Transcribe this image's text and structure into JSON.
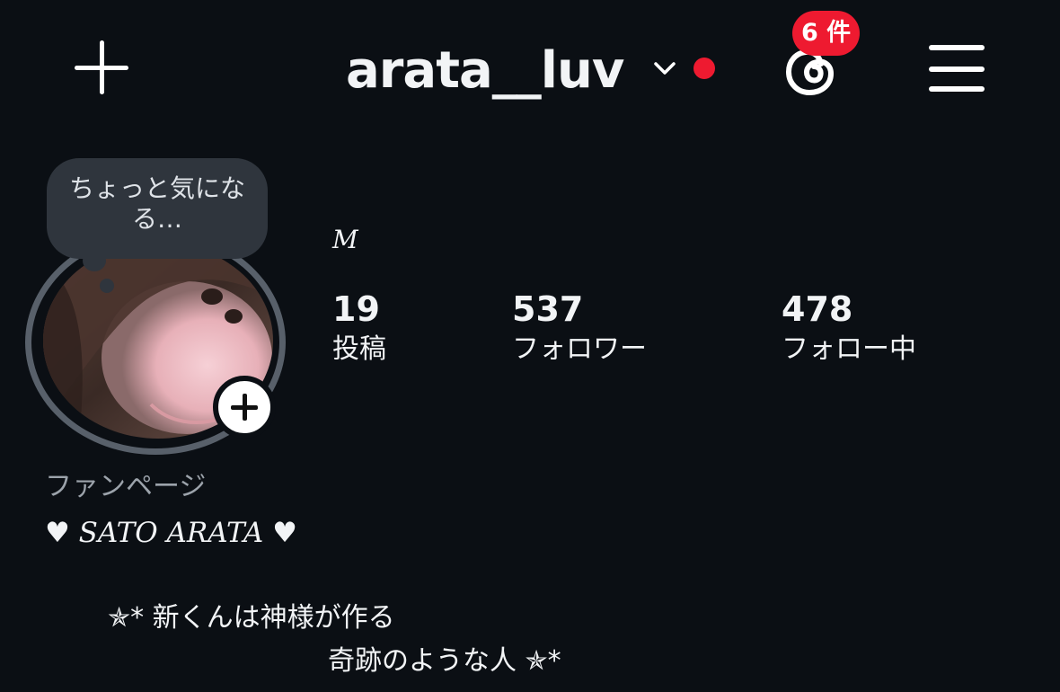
{
  "header": {
    "username": "arata__luv",
    "notification_badge": "6 件"
  },
  "note": {
    "text": "ちょっと気になる…"
  },
  "profile": {
    "display_name": "M",
    "category": "ファンページ",
    "bio_name": "♥ SATO ARATA ♥",
    "bio_line1": "✯* 新くんは神様が作る",
    "bio_line2": "奇跡のような人 ✯*"
  },
  "stats": {
    "posts": {
      "count": "19",
      "label": "投稿"
    },
    "followers": {
      "count": "537",
      "label": "フォロワー"
    },
    "following": {
      "count": "478",
      "label": "フォロー中"
    }
  },
  "colors": {
    "background": "#0b0f14",
    "accent_red": "#ee1a30",
    "note_bubble": "#2f353d",
    "ring": "#58606a"
  },
  "icons": [
    "plus-icon",
    "chevron-down-icon",
    "threads-icon",
    "hamburger-menu-icon",
    "add-story-icon"
  ]
}
